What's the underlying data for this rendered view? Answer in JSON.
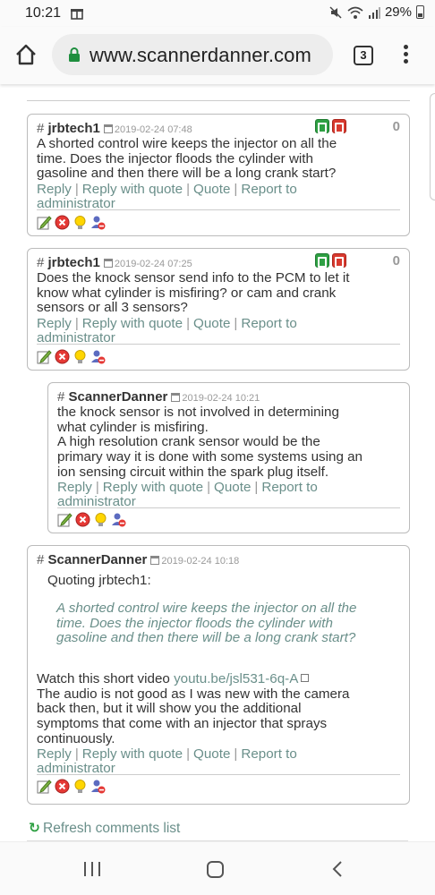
{
  "status": {
    "time": "10:21",
    "battery": "29%"
  },
  "browser": {
    "url": "www.scannerdanner.com",
    "tab_count": "3"
  },
  "links": {
    "reply": "Reply",
    "reply_quote": "Reply with quote",
    "quote": "Quote",
    "report_to": "Report to",
    "administrator": "administrator"
  },
  "comments": [
    {
      "hash": "#",
      "author": "jrbtech1",
      "date": "2019-02-24 07:48",
      "votes": "0",
      "body": [
        "A shorted control wire keeps the injector on all the",
        "time. Does the injector floods the cylinder with",
        "gasoline and then there will be a long crank start?"
      ]
    },
    {
      "hash": "#",
      "author": "jrbtech1",
      "date": "2019-02-24 07:25",
      "votes": "0",
      "body": [
        "Does the knock sensor send info to the PCM to let it",
        "know what cylinder is misfiring? or cam and crank",
        "sensors or all 3 sensors?"
      ]
    },
    {
      "hash": "#",
      "author": "ScannerDanner",
      "date": "2019-02-24 10:21",
      "body": [
        "the knock sensor is not involved in determining",
        "what cylinder is misfiring.",
        "A high resolution crank sensor would be the",
        "primary way it is done with some systems using an",
        "ion sensing circuit within the spark plug itself."
      ]
    },
    {
      "hash": "#",
      "author": "ScannerDanner",
      "date": "2019-02-24 10:18",
      "quoting_label": "Quoting jrbtech1:",
      "quote": [
        "A shorted control wire keeps the injector on all the",
        "time. Does the injector floods the cylinder with",
        "gasoline and then there will be a long crank start?"
      ],
      "video_prefix": "Watch this short video ",
      "video_link": "youtu.be/jsl531-6q-A",
      "body": [
        "The audio is not good as I was new with the camera",
        "back then, but it will show you the additional",
        "symptoms that come with an injector that sprays",
        "continuously."
      ]
    }
  ],
  "refresh_label": "Refresh comments list",
  "colors": {
    "link": "#6a8f8a",
    "vote_up": "#2ea043",
    "vote_down": "#d83a2f"
  }
}
